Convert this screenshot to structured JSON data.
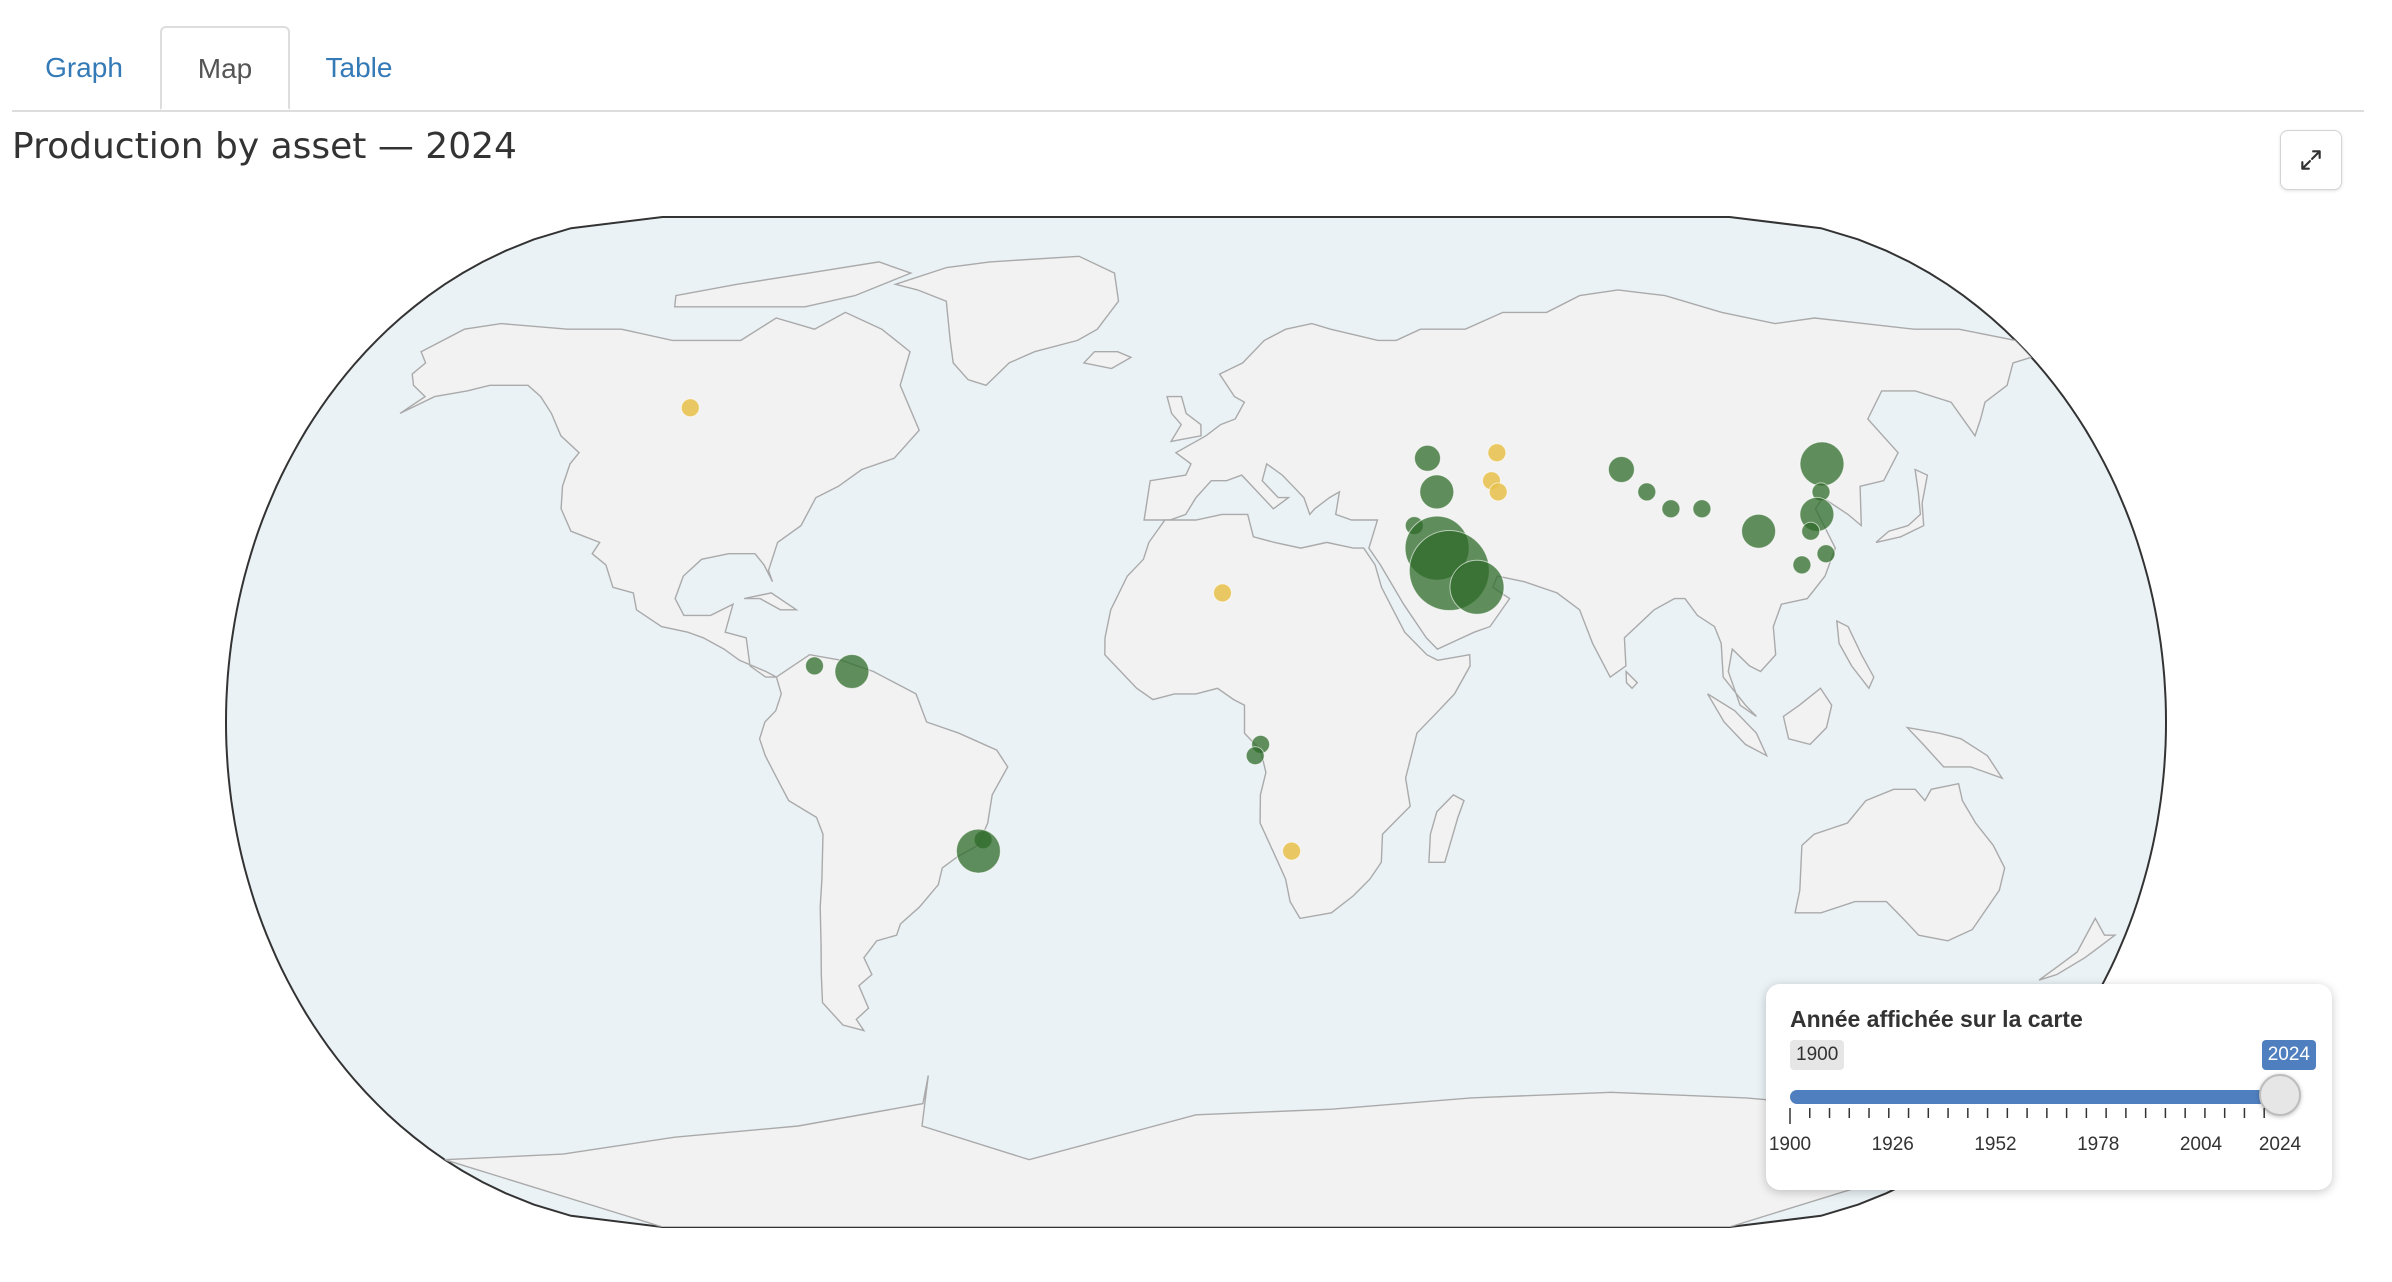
{
  "tabs": [
    {
      "label": "Graph",
      "active": false
    },
    {
      "label": "Map",
      "active": true
    },
    {
      "label": "Table",
      "active": false
    }
  ],
  "title": "Production by asset — 2024",
  "expand_icon": "expand-arrows-icon",
  "slider": {
    "title": "Année affichée sur la carte",
    "min": 1900,
    "max": 2024,
    "value": 2024,
    "min_label": "1900",
    "value_label": "2024",
    "tick_labels": [
      "1900",
      "1926",
      "1952",
      "1978",
      "2004",
      "2024"
    ]
  },
  "colors": {
    "ocean": "#eaf2f6",
    "land": "#f2f2f2",
    "border": "#aaaaaa",
    "marker_green": "#2f6b2a",
    "marker_yellow": "#e8c14a",
    "accent": "#4f7fbf",
    "tab_link": "#337ab7"
  },
  "markers": [
    {
      "region": "Canada",
      "lon": -104,
      "lat": 56,
      "size": 1,
      "color": "yellow"
    },
    {
      "region": "Venezuela",
      "lon": -71,
      "lat": 10,
      "size": 1,
      "color": "green"
    },
    {
      "region": "Venezuela",
      "lon": -64,
      "lat": 9,
      "size": 3,
      "color": "green"
    },
    {
      "region": "Brazil",
      "lon": -40,
      "lat": -21,
      "size": 1,
      "color": "green"
    },
    {
      "region": "Brazil",
      "lon": -41,
      "lat": -23,
      "size": 4,
      "color": "green"
    },
    {
      "region": "Algeria",
      "lon": 5,
      "lat": 23,
      "size": 1,
      "color": "yellow"
    },
    {
      "region": "Angola",
      "lon": 12,
      "lat": -4,
      "size": 1,
      "color": "green"
    },
    {
      "region": "Angola",
      "lon": 11,
      "lat": -6,
      "size": 1,
      "color": "green"
    },
    {
      "region": "Namibia",
      "lon": 18,
      "lat": -23,
      "size": 1,
      "color": "yellow"
    },
    {
      "region": "Russia",
      "lon": 46,
      "lat": 47,
      "size": 2,
      "color": "green"
    },
    {
      "region": "Azerbaijan",
      "lon": 47,
      "lat": 41,
      "size": 3,
      "color": "green"
    },
    {
      "region": "Iraq",
      "lon": 42,
      "lat": 35,
      "size": 1,
      "color": "green"
    },
    {
      "region": "Iraq",
      "lon": 46,
      "lat": 31,
      "size": 6,
      "color": "green"
    },
    {
      "region": "Saudi Arabia",
      "lon": 48,
      "lat": 27,
      "size": 8,
      "color": "green"
    },
    {
      "region": "UAE",
      "lon": 53,
      "lat": 24,
      "size": 5,
      "color": "green"
    },
    {
      "region": "Kazakhstan",
      "lon": 60,
      "lat": 48,
      "size": 1,
      "color": "yellow"
    },
    {
      "region": "Uzbekistan",
      "lon": 58,
      "lat": 43,
      "size": 1,
      "color": "yellow"
    },
    {
      "region": "Uzbekistan",
      "lon": 59,
      "lat": 41,
      "size": 1,
      "color": "yellow"
    },
    {
      "region": "China",
      "lon": 84,
      "lat": 45,
      "size": 2,
      "color": "green"
    },
    {
      "region": "China",
      "lon": 88,
      "lat": 41,
      "size": 1,
      "color": "green"
    },
    {
      "region": "China",
      "lon": 92,
      "lat": 38,
      "size": 1,
      "color": "green"
    },
    {
      "region": "China",
      "lon": 98,
      "lat": 38,
      "size": 1,
      "color": "green"
    },
    {
      "region": "China",
      "lon": 108,
      "lat": 34,
      "size": 3,
      "color": "green"
    },
    {
      "region": "China",
      "lon": 124,
      "lat": 46,
      "size": 4,
      "color": "green"
    },
    {
      "region": "China",
      "lon": 122,
      "lat": 41,
      "size": 1,
      "color": "green"
    },
    {
      "region": "China",
      "lon": 120,
      "lat": 37,
      "size": 3,
      "color": "green"
    },
    {
      "region": "China",
      "lon": 118,
      "lat": 34,
      "size": 1,
      "color": "green"
    },
    {
      "region": "China",
      "lon": 115,
      "lat": 28,
      "size": 1,
      "color": "green"
    },
    {
      "region": "China",
      "lon": 120,
      "lat": 30,
      "size": 1,
      "color": "green"
    }
  ]
}
